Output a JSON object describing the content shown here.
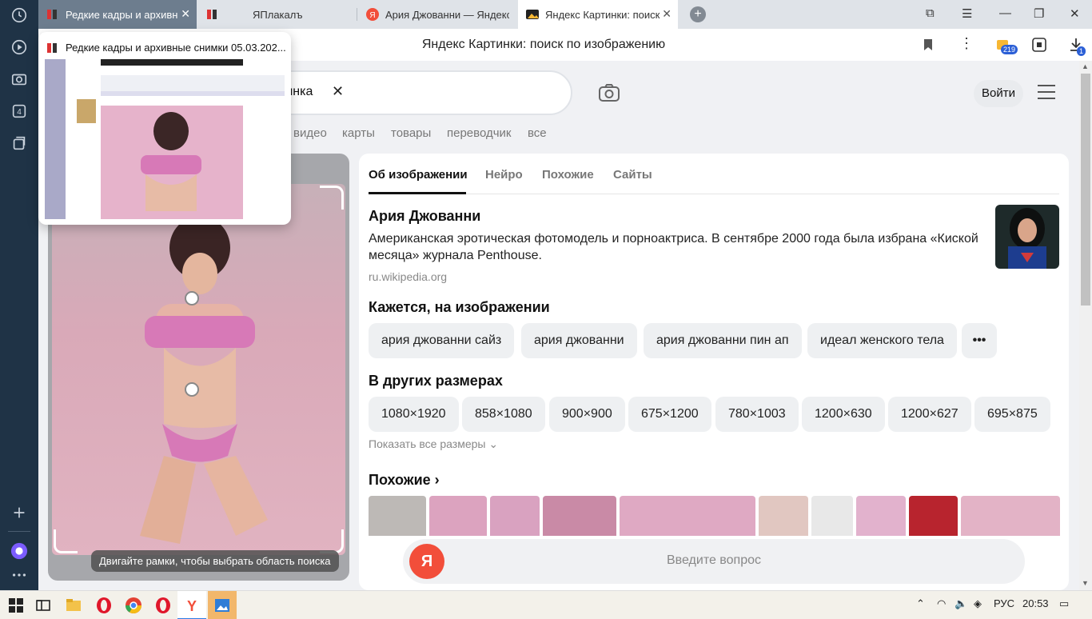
{
  "colors": {
    "accent_red": "#f24e3a",
    "sidebar": "#1f3346",
    "active_tab": "#ffffff"
  },
  "tabs": [
    {
      "label": "Редкие кадры и архивные",
      "icon": "yaplakal-icon"
    },
    {
      "label": "ЯПлакалъ",
      "icon": "yaplakal-icon"
    },
    {
      "label": "Ария Джованни — Яндекс",
      "icon": "yandex-icon"
    },
    {
      "label": "Яндекс Картинки: поиск",
      "icon": "yandex-images-icon"
    }
  ],
  "address_bar": {
    "title": "Яндекс Картинки: поиск по изображению",
    "badge_count": "219",
    "downloads_badge": "1"
  },
  "preview": {
    "title": "Редкие кадры и архивные снимки 05.03.202..."
  },
  "search": {
    "query": "тинка"
  },
  "header": {
    "login": "Войти"
  },
  "services": [
    "видео",
    "карты",
    "товары",
    "переводчик",
    "все"
  ],
  "image_panel": {
    "hint": "Двигайте рамки, чтобы выбрать область поиска"
  },
  "card": {
    "tabs": [
      "Об изображении",
      "Нейро",
      "Похожие",
      "Сайты"
    ],
    "entity": {
      "name": "Ария Джованни",
      "description": "Американская эротическая фотомодель и порноактриса. В сентябре 2000 года была избрана «Киской месяца» журнала Penthouse.",
      "source": "ru.wikipedia.org"
    },
    "seems_heading": "Кажется, на изображении",
    "tags": [
      "ария джованни сайз",
      "ария джованни",
      "ария джованни пин ап",
      "идеал женского тела"
    ],
    "sizes_heading": "В других размерах",
    "sizes": [
      "1080×1920",
      "858×1080",
      "900×900",
      "675×1200",
      "780×1003",
      "1200×630",
      "1200×627",
      "695×875"
    ],
    "show_all_sizes": "Показать все размеры",
    "similar_heading": "Похожие"
  },
  "ask": {
    "placeholder": "Введите вопрос"
  },
  "taskbar": {
    "lang": "РУС",
    "time": "20:53"
  }
}
